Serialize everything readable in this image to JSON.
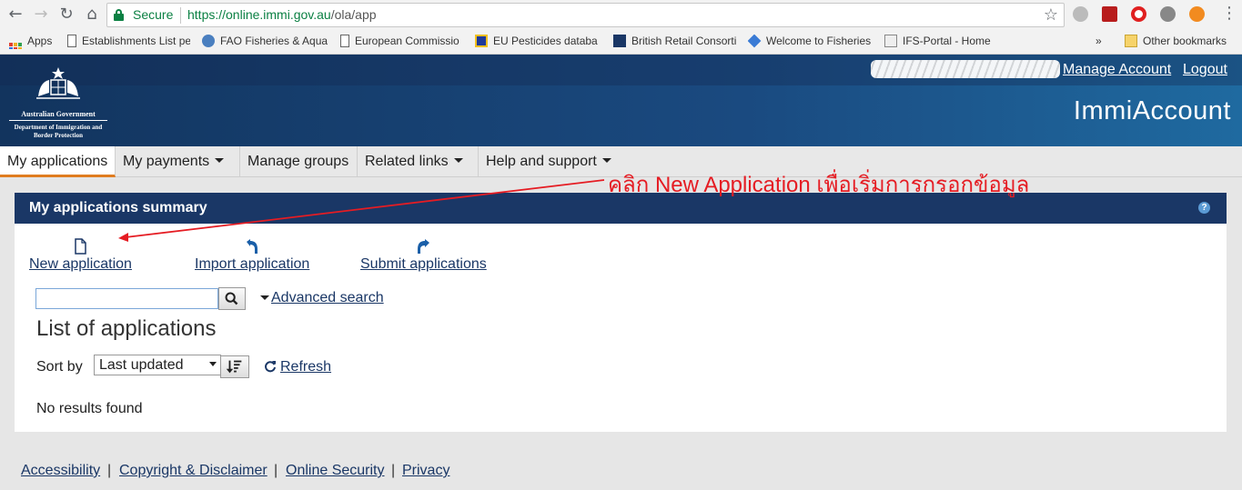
{
  "browser": {
    "secure_label": "Secure",
    "url_host": "https://online.immi.gov.au",
    "url_path": "/ola/app",
    "bookmarks": [
      "Apps",
      "Establishments List pe",
      "FAO Fisheries & Aqua",
      "European Commissio",
      "EU Pesticides databa",
      "British Retail Consorti",
      "Welcome to Fisheries",
      "IFS-Portal - Home"
    ],
    "overflow": "»",
    "other_bookmarks": "Other bookmarks"
  },
  "header": {
    "agency_line1": "Australian Government",
    "agency_line2": "Department of Immigration and Border Protection",
    "manage_account": "Manage Account",
    "logout": "Logout",
    "app_title": "ImmiAccount"
  },
  "menu": {
    "items": [
      "My applications",
      "My payments",
      "Manage groups",
      "Related links",
      "Help and support"
    ]
  },
  "panel": {
    "title": "My applications summary",
    "help": "?",
    "actions": {
      "new_application": "New application",
      "import_application": "Import application",
      "submit_applications": "Submit applications"
    },
    "search_value": "",
    "advanced_search": "Advanced search",
    "list_title": "List of applications",
    "sort_label": "Sort by",
    "sort_value": "Last updated",
    "refresh": "Refresh",
    "no_results": "No results found"
  },
  "annotation": {
    "text": "คลิก New Application เพื่อเริ่มการกรอกข้อมูล",
    "color": "#e51c23"
  },
  "footer": {
    "links": [
      "Accessibility",
      "Copyright & Disclaimer",
      "Online Security",
      "Privacy"
    ],
    "separator": "|"
  }
}
